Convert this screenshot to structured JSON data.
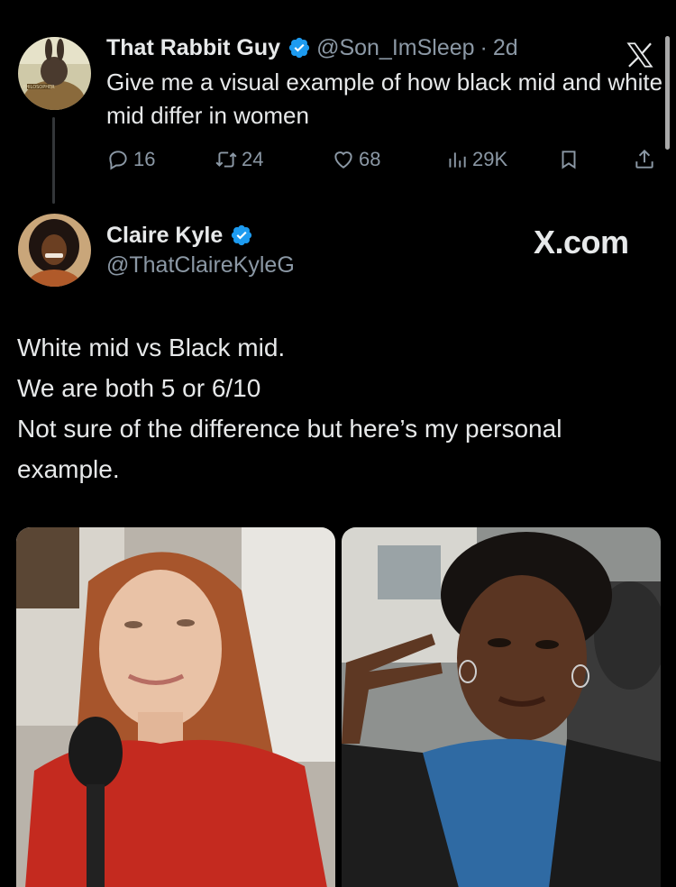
{
  "tweet1": {
    "display_name": "That Rabbit Guy",
    "handle": "@Son_ImSleep",
    "separator": "·",
    "age": "2d",
    "text": "Give me a visual example of how black mid and white mid differ in women",
    "avatar_caption": "PHILOSOPHER",
    "stats": {
      "replies": "16",
      "retweets": "24",
      "likes": "68",
      "views": "29K"
    }
  },
  "tweet2": {
    "display_name": "Claire Kyle",
    "handle": "@ThatClaireKyleG",
    "watermark": "X.com",
    "lines": [
      "White mid vs Black mid.",
      "We are both 5 or 6/10",
      "Not sure of the difference but here’s my personal",
      "example."
    ]
  },
  "colors": {
    "background": "#000000",
    "text": "#e7e9ea",
    "muted": "#8b98a5",
    "verified": "#1d9bf0",
    "thread_line": "#333639"
  },
  "icons": [
    "x-logo-icon",
    "verified-badge-icon",
    "reply-icon",
    "retweet-icon",
    "like-icon",
    "views-icon",
    "bookmark-icon",
    "share-icon"
  ]
}
